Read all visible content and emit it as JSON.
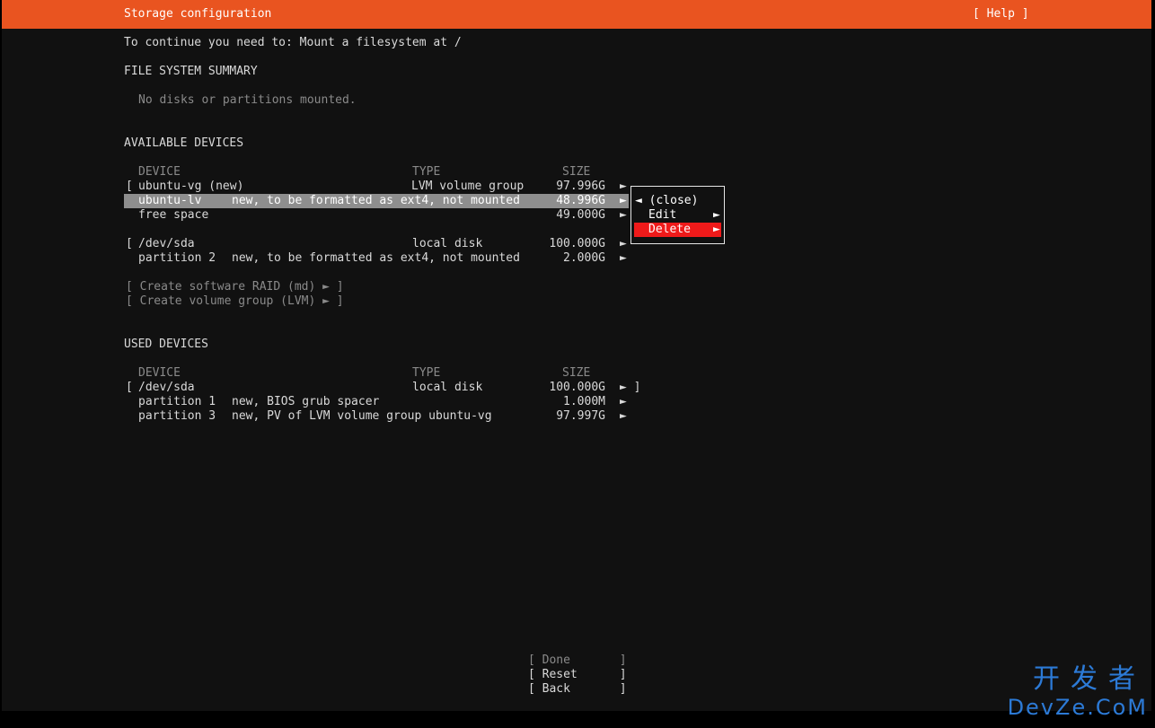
{
  "header": {
    "title": "Storage configuration",
    "help": "[ Help ]"
  },
  "instruction": "To continue you need to: Mount a filesystem at /",
  "fs_summary": {
    "heading": "FILE SYSTEM SUMMARY",
    "empty_text": "No disks or partitions mounted."
  },
  "available": {
    "heading": "AVAILABLE DEVICES",
    "col_device": "DEVICE",
    "col_type": "TYPE",
    "col_size": "SIZE",
    "rows": [
      {
        "bracket": "[",
        "device": "ubuntu-vg (new)",
        "type": "LVM volume group",
        "size": "97.996G",
        "arrow": "►"
      },
      {
        "bracket": "",
        "device": "ubuntu-lv",
        "type": "new, to be formatted as ext4, not mounted",
        "size": "48.996G",
        "arrow": "►"
      },
      {
        "bracket": "",
        "device": "free space",
        "type": "",
        "size": "49.000G",
        "arrow": "►"
      },
      {
        "bracket": "[",
        "device": "/dev/sda",
        "type": "local disk",
        "size": "100.000G",
        "arrow": "►"
      },
      {
        "bracket": "",
        "device": "partition 2",
        "type": "new, to be formatted as ext4, not mounted",
        "size": "2.000G",
        "arrow": "►"
      }
    ],
    "create_raid": "[ Create software RAID (md) ► ]",
    "create_vg": "[ Create volume group (LVM) ► ]"
  },
  "context_menu": {
    "close": "◄ (close)",
    "edit": "Edit",
    "edit_arrow": "►",
    "delete": "Delete",
    "delete_arrow": "►"
  },
  "used": {
    "heading": "USED DEVICES",
    "col_device": "DEVICE",
    "col_type": "TYPE",
    "col_size": "SIZE",
    "rows": [
      {
        "bracket": "[",
        "device": "/dev/sda",
        "type": "local disk",
        "size": "100.000G",
        "arrow": "► ]"
      },
      {
        "bracket": "",
        "device": "partition 1",
        "type": "new, BIOS grub spacer",
        "size": "1.000M",
        "arrow": "►"
      },
      {
        "bracket": "",
        "device": "partition 3",
        "type": "new, PV of LVM volume group ubuntu-vg",
        "size": "97.997G",
        "arrow": "►"
      }
    ]
  },
  "buttons": {
    "done": "[ Done       ]",
    "reset": "[ Reset      ]",
    "back": "[ Back       ]"
  },
  "watermark": {
    "top": "开发者",
    "bottom": "DevZe.CoM"
  },
  "colors": {
    "accent": "#e95420",
    "background": "#111111",
    "highlight": "#8e8e8e",
    "danger": "#ef1a1a"
  }
}
